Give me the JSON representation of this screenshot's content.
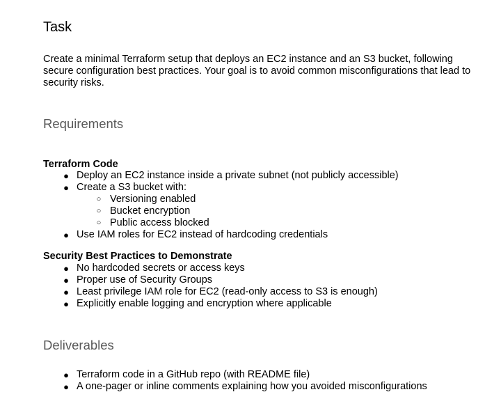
{
  "task": {
    "heading": "Task",
    "intro": "Create a minimal Terraform setup that deploys an EC2 instance and an S3 bucket, following secure configuration best practices. Your goal is to avoid common misconfigurations that lead to security risks."
  },
  "requirements": {
    "heading": "Requirements",
    "terraform_code": {
      "heading": "Terraform Code",
      "items": [
        "Deploy an EC2 instance inside a private subnet (not publicly accessible)",
        "Create a S3 bucket with:"
      ],
      "s3_subitems": [
        "Versioning enabled",
        "Bucket encryption",
        "Public access blocked"
      ],
      "last_item": "Use IAM roles for EC2 instead of hardcoding credentials"
    },
    "security": {
      "heading": "Security Best Practices to Demonstrate",
      "items": [
        "No hardcoded secrets or access keys",
        "Proper use of Security Groups",
        "Least privilege IAM role for EC2 (read-only access to S3 is enough)",
        "Explicitly enable logging and encryption where applicable"
      ]
    }
  },
  "deliverables": {
    "heading": "Deliverables",
    "items": [
      "Terraform code in a GitHub repo (with README file)",
      "A one-pager or inline comments explaining how you avoided misconfigurations"
    ]
  },
  "bullets": {
    "filled": "●",
    "hollow": "○"
  }
}
